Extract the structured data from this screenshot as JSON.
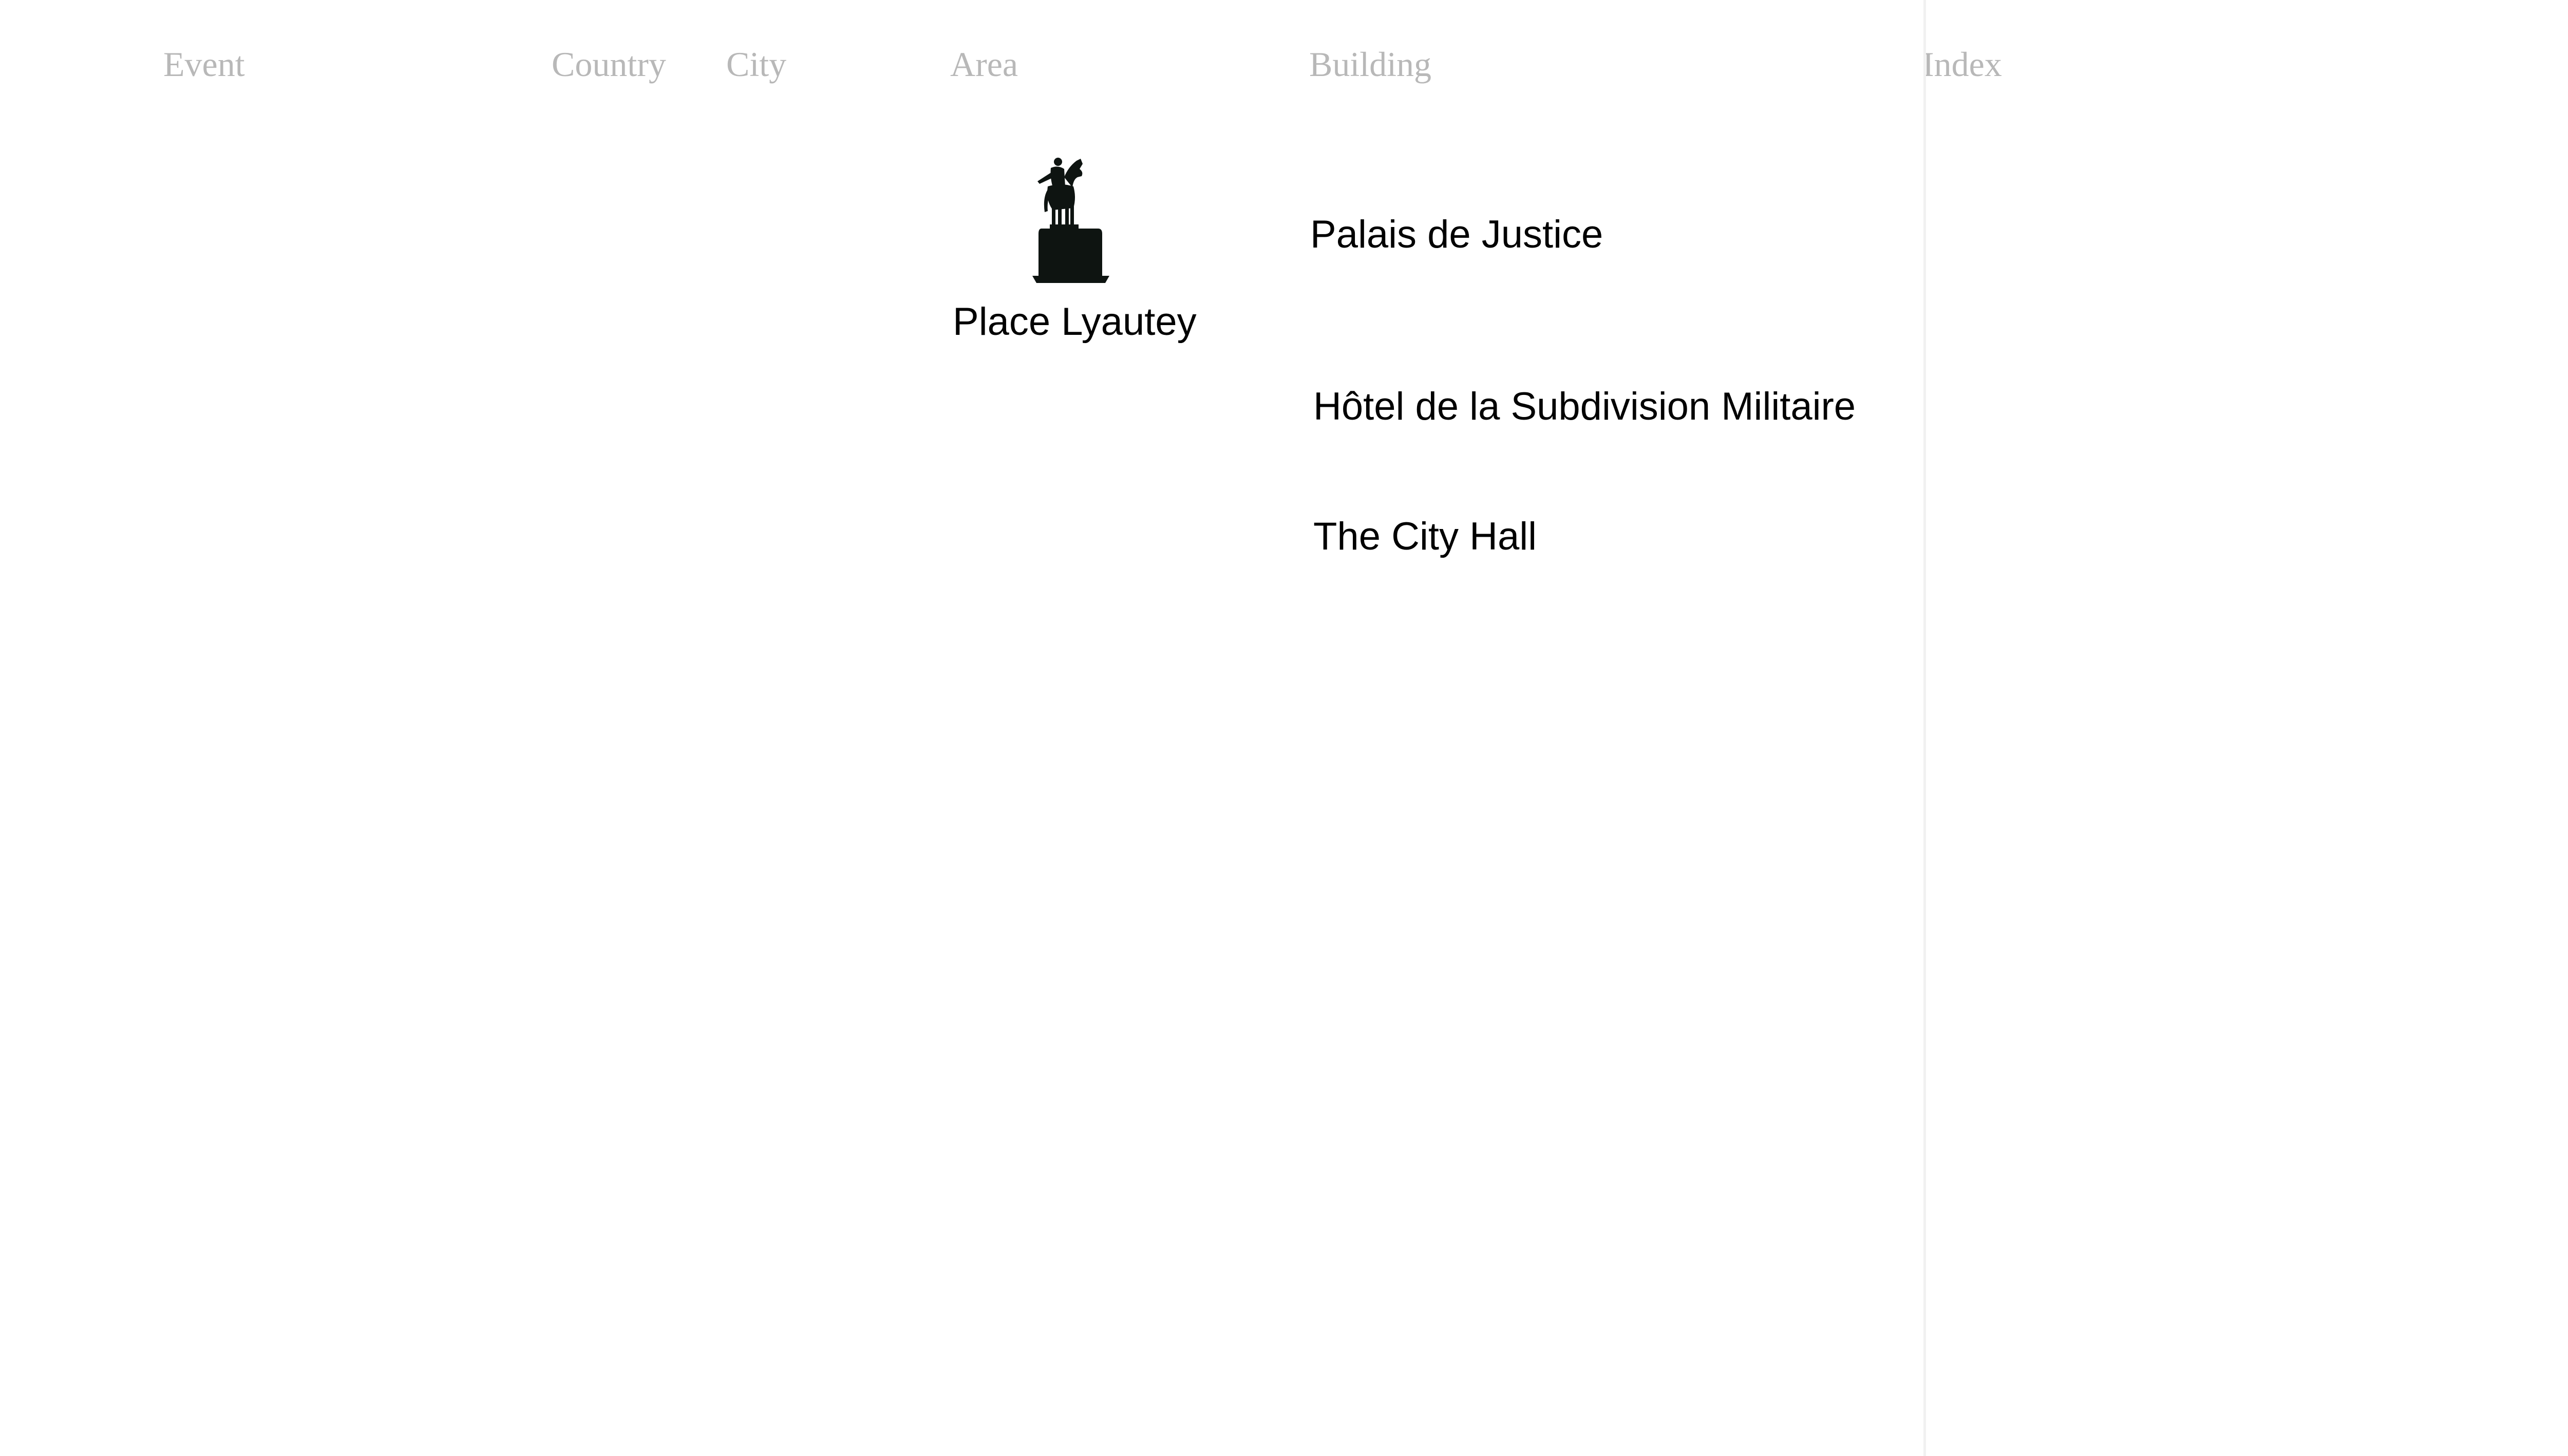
{
  "nav": {
    "event": "Event",
    "country": "Country",
    "city": "City",
    "area": "Area",
    "building": "Building",
    "index": "Index"
  },
  "area": {
    "name": "Place Lyautey",
    "icon": "equestrian-statue-icon"
  },
  "buildings": [
    "Palais de Justice",
    "Hôtel de la Subdivision Militaire",
    "The City Hall"
  ],
  "colors": {
    "nav_text": "#b8b8b8",
    "body_text": "#000000",
    "statue": "#0e1411",
    "divider": "#f1f1f1",
    "background": "#ffffff"
  }
}
